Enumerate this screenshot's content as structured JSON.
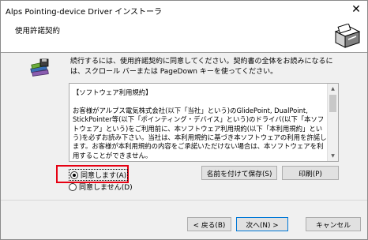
{
  "window": {
    "title": "Alps Pointing-device Driver インストーラ",
    "close_glyph": "✕"
  },
  "header": {
    "title": "使用許諾契約"
  },
  "intro": {
    "text": "続行するには、使用許諾契約に同意してください。契約書の全体をお読みになるには、スクロール バーまたは PageDown キーを使ってください。"
  },
  "license": {
    "text": "【ソフトウェア利用規約】\n\nお客様がアルプス電気株式会社(以下「当社」という)のGlidePoint, DualPoint, StickPointer等(以下「ポインティング・デバイス」という)のドライバ(以下「本ソフトウェア」という)をご利用前に、本ソフトウェア利用規約(以下「本利用規約」という)を必ずお読み下さい。当社は、本利用規約に基づき本ソフトウェアの利用を許諾します。お客様が本利用規約の内容をご承諾いただけない場合は、本ソフトウェアを利用することができません。"
  },
  "options": {
    "agree_label": "同意します(A)",
    "disagree_label": "同意しません(D)",
    "selected": "agree"
  },
  "buttons": {
    "save_label": "名前を付けて保存(S)",
    "print_label": "印刷(P)",
    "back_label": "< 戻る(B)",
    "next_label": "次へ(N) >",
    "cancel_label": "キャンセル"
  },
  "colors": {
    "highlight": "#e60012",
    "focus_border": "#0078d7"
  },
  "icons": {
    "header": "installer-box-icon",
    "intro": "books-disk-icon"
  }
}
